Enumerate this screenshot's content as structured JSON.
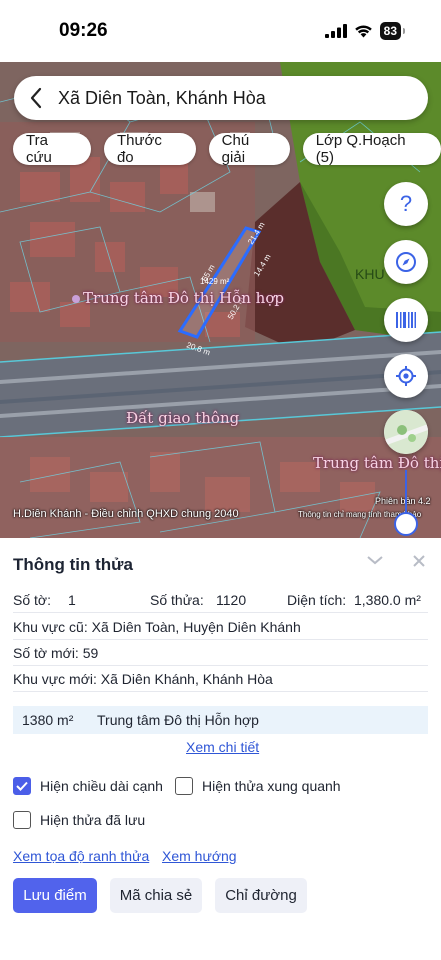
{
  "status_bar": {
    "time": "09:26",
    "battery": "83"
  },
  "search": {
    "text": "Xã Diên Toàn, Khánh Hòa"
  },
  "chips": [
    "Tra cứu",
    "Thước đo",
    "Chú giải",
    "Lớp Q.Hoạch (5)"
  ],
  "fabs": [
    "help-icon",
    "compass-icon",
    "barcode-icon",
    "locate-icon",
    "thumbnail-map"
  ],
  "map": {
    "zone_labels": [
      "Trung tâm Đô thị Hỗn hợp",
      "Đất giao thông",
      "Trung tâm Đô thị H",
      "KHU"
    ],
    "parcel_edges": [
      "21.4 m",
      "14.4 m",
      "65 m",
      "50.2 m",
      "20.8 m"
    ],
    "parcel_area": "1429 m²",
    "attribution_left": "H.Diên Khánh - Điều chỉnh QHXD chung 2040",
    "attribution_right": "Thông tin chỉ mang tính tham khảo",
    "scale": "Phiên bản 4.2"
  },
  "sheet": {
    "title": "Thông tin thửa",
    "so_to_label": "Số tờ:",
    "so_to_value": "1",
    "so_thua_label": "Số thửa:",
    "so_thua_value": "1120",
    "dien_tich_label": "Diện tích:",
    "dien_tich_value": "1,380.0 m²",
    "khu_vuc_cu": "Khu vực cũ: Xã Diên Toàn, Huyện Diên Khánh",
    "so_to_moi": "Số tờ mới: 59",
    "khu_vuc_moi": "Khu vực mới: Xã Diên Khánh, Khánh Hòa",
    "zone_area": "1380 m²",
    "zone_name": "Trung tâm Đô thị Hỗn hợp",
    "view_detail": "Xem chi tiết",
    "checkbox_edges": "Hiện chiều dài cạnh",
    "checkbox_edges_checked": true,
    "checkbox_neighbors": "Hiện thửa xung quanh",
    "checkbox_saved": "Hiện thửa đã lưu",
    "link_coords": "Xem tọa độ ranh thửa",
    "link_direction": "Xem hướng",
    "btn_save": "Lưu điểm",
    "btn_share": "Mã chia sẻ",
    "btn_directions": "Chỉ đường"
  },
  "colors": {
    "accent": "#5163ec",
    "link": "#2f56d6",
    "zone_fill": "#eaf3fb",
    "parcel_outline": "#2b6cff"
  }
}
